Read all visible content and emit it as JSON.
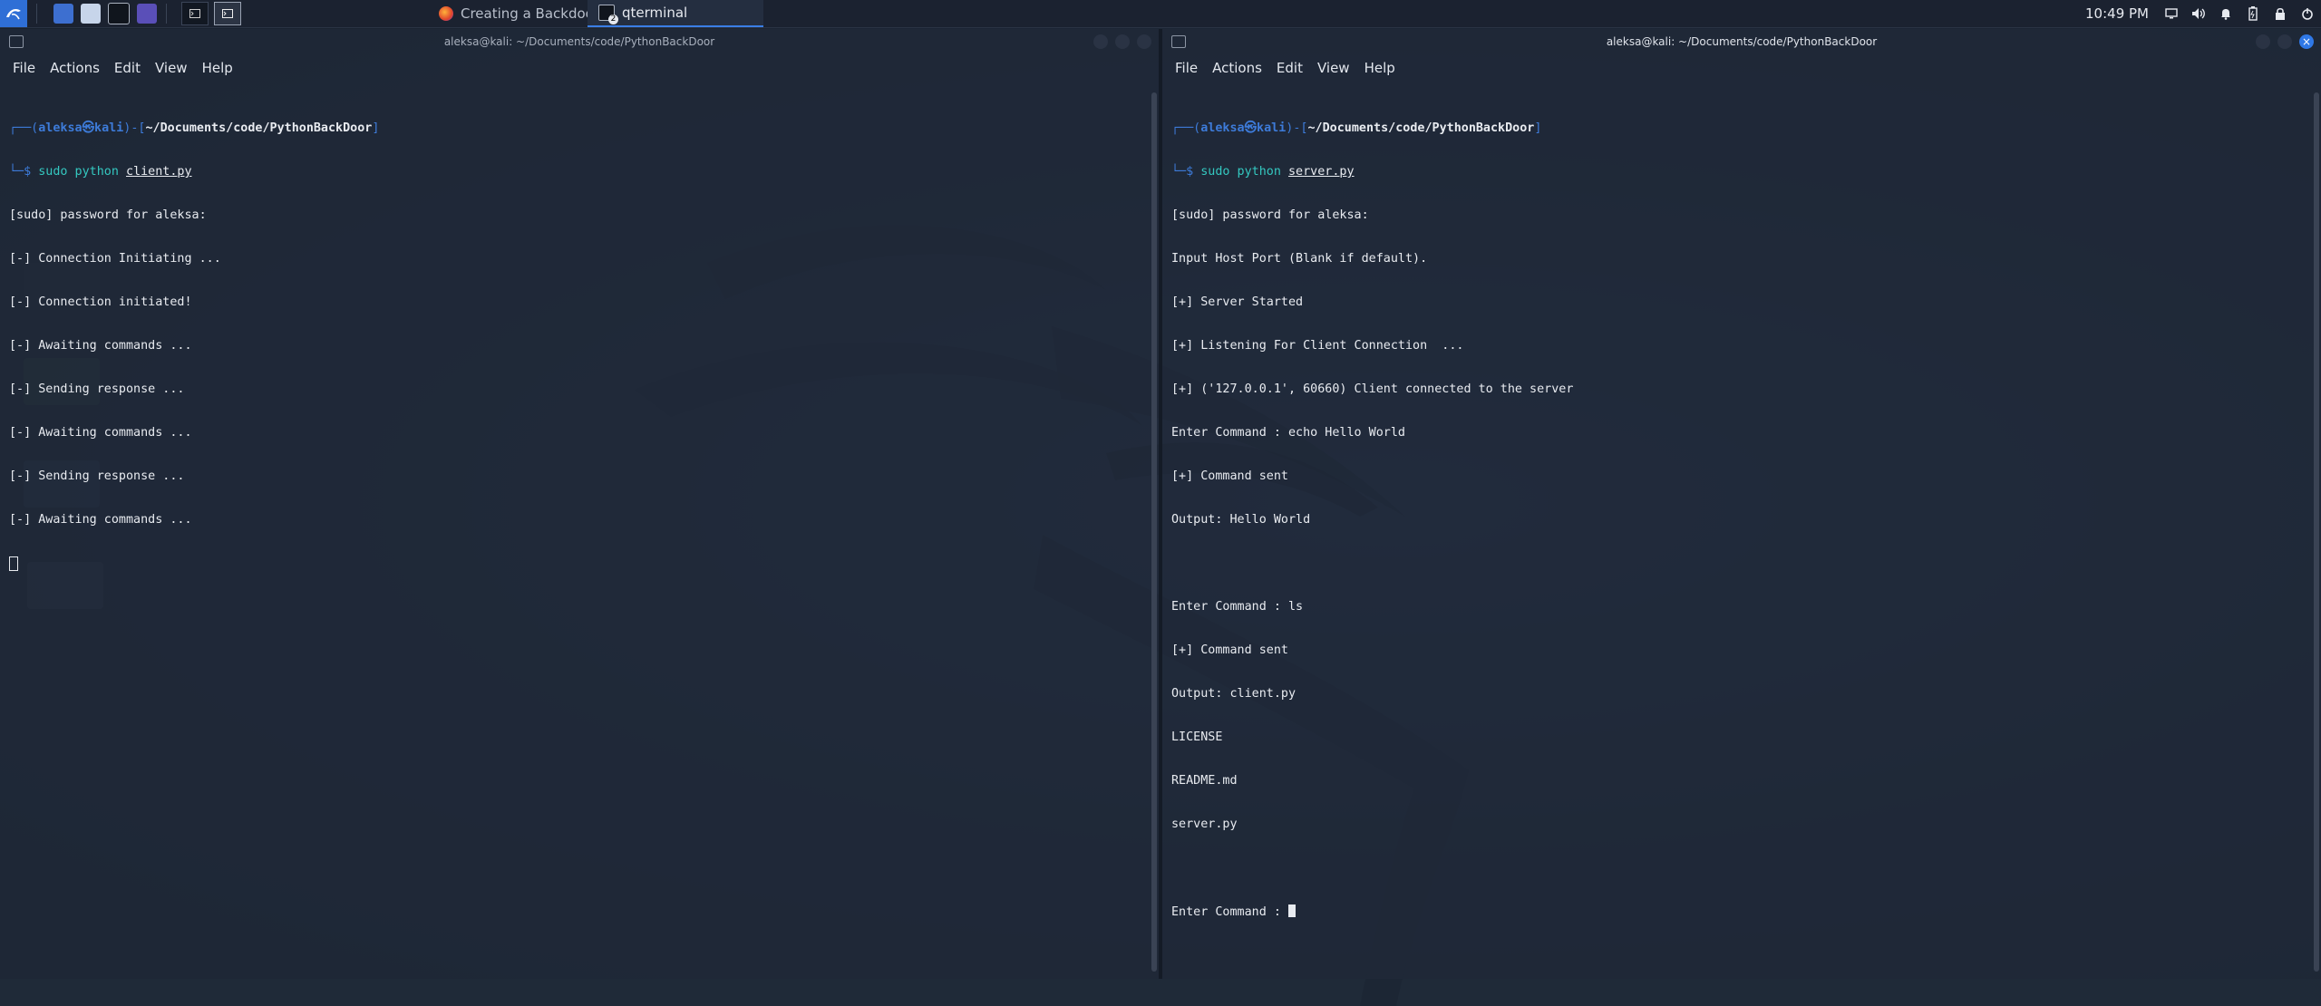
{
  "panel": {
    "tasks": [
      {
        "label": "Creating a Backdoor in ...",
        "icon": "firefox-icon",
        "active": false
      },
      {
        "label": "qterminal",
        "icon": "terminal-icon",
        "badge": "2",
        "active": true
      }
    ],
    "clock": "10:49 PM"
  },
  "left": {
    "title": "aleksa@kali: ~/Documents/code/PythonBackDoor",
    "menu": [
      "File",
      "Actions",
      "Edit",
      "View",
      "Help"
    ],
    "prompt": {
      "frame_top": "┌──(",
      "user": "aleksa㉿kali",
      "mid": ")-[",
      "path": "~/Documents/code/PythonBackDoor",
      "end": "]",
      "frame_bottom": "└─$ ",
      "cmd": "sudo",
      "cmd2": " python ",
      "arg": "client.py"
    },
    "lines": [
      "[sudo] password for aleksa:",
      "[-] Connection Initiating ...",
      "[-] Connection initiated!",
      "[-] Awaiting commands ...",
      "[-] Sending response ...",
      "[-] Awaiting commands ...",
      "[-] Sending response ...",
      "[-] Awaiting commands ..."
    ]
  },
  "right": {
    "title": "aleksa@kali: ~/Documents/code/PythonBackDoor",
    "menu": [
      "File",
      "Actions",
      "Edit",
      "View",
      "Help"
    ],
    "prompt": {
      "frame_top": "┌──(",
      "user": "aleksa㉿kali",
      "mid": ")-[",
      "path": "~/Documents/code/PythonBackDoor",
      "end": "]",
      "frame_bottom": "└─$ ",
      "cmd": "sudo",
      "cmd2": " python ",
      "arg": "server.py"
    },
    "lines": [
      "[sudo] password for aleksa:",
      "Input Host Port (Blank if default).",
      "[+] Server Started",
      "[+] Listening For Client Connection  ...",
      "[+] ('127.0.0.1', 60660) Client connected to the server",
      "Enter Command : echo Hello World",
      "[+] Command sent",
      "Output: Hello World",
      "",
      "Enter Command : ls",
      "[+] Command sent",
      "Output: client.py",
      "LICENSE",
      "README.md",
      "server.py",
      ""
    ],
    "last_line": "Enter Command : "
  }
}
